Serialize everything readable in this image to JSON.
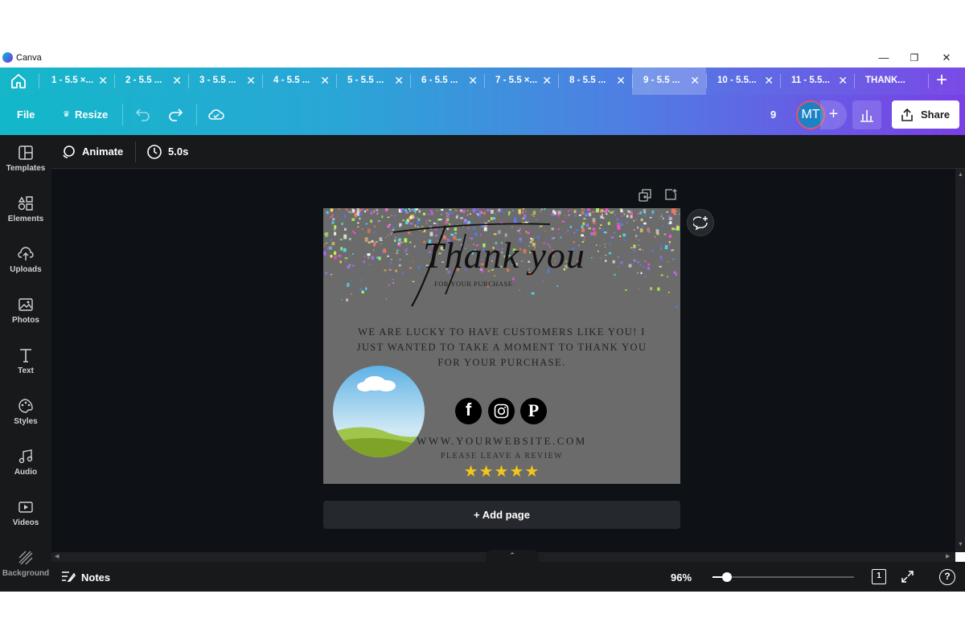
{
  "app": {
    "title": "Canva"
  },
  "window_controls": {
    "minimize": "—",
    "maximize": "❐",
    "close": "✕"
  },
  "tabs": [
    {
      "label": "1 - 5.5 ×..."
    },
    {
      "label": "2 - 5.5 ..."
    },
    {
      "label": "3 - 5.5 ..."
    },
    {
      "label": "4 - 5.5 ..."
    },
    {
      "label": "5 - 5.5 ..."
    },
    {
      "label": "6 - 5.5 ..."
    },
    {
      "label": "7 - 5.5 ×..."
    },
    {
      "label": "8 - 5.5 ..."
    },
    {
      "label": "9 - 5.5 ...",
      "active": true
    },
    {
      "label": "10 - 5.5..."
    },
    {
      "label": "11 - 5.5..."
    },
    {
      "label": "THANK..."
    }
  ],
  "toolbar": {
    "file": "File",
    "resize": "Resize",
    "collaborator_count": "9",
    "avatar_initials": "MT",
    "share": "Share"
  },
  "sidebar": {
    "items": [
      {
        "label": "Templates",
        "icon": "templates-icon"
      },
      {
        "label": "Elements",
        "icon": "elements-icon"
      },
      {
        "label": "Uploads",
        "icon": "uploads-icon"
      },
      {
        "label": "Photos",
        "icon": "photos-icon"
      },
      {
        "label": "Text",
        "icon": "text-icon"
      },
      {
        "label": "Styles",
        "icon": "styles-icon"
      },
      {
        "label": "Audio",
        "icon": "audio-icon"
      },
      {
        "label": "Videos",
        "icon": "videos-icon"
      },
      {
        "label": "Background",
        "icon": "background-icon"
      }
    ]
  },
  "context": {
    "animate": "Animate",
    "duration": "5.0s"
  },
  "design": {
    "script_title": "Thank you",
    "subtitle": "FOR YOUR PURCHASE",
    "message": "WE ARE LUCKY TO HAVE CUSTOMERS LIKE YOU! I JUST WANTED TO TAKE A MOMENT TO THANK YOU FOR YOUR PURCHASE.",
    "website": "WWW.YOURWEBSITE.COM",
    "review": "PLEASE LEAVE A REVIEW",
    "stars": "★★★★★",
    "star_rating": 5,
    "social": [
      "facebook",
      "instagram",
      "pinterest"
    ]
  },
  "add_page": "+ Add page",
  "bottom": {
    "notes": "Notes",
    "zoom": "96%",
    "zoom_level": 0.1,
    "page_number": "1"
  },
  "colors": {
    "canvas_bg": "#6b6b6b",
    "workspace_bg": "#0e1115",
    "sidebar_bg": "#18191b",
    "star_color": "#f5c518",
    "avatar_bg": "#1c82c7"
  }
}
